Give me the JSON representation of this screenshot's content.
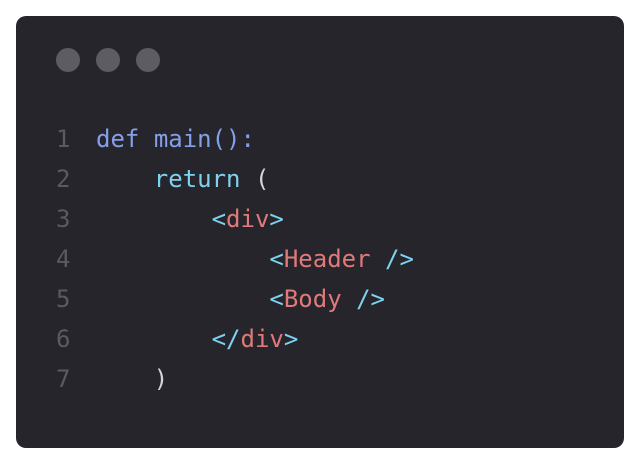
{
  "window": {
    "controls": [
      "dot",
      "dot",
      "dot"
    ],
    "colors": {
      "background": "#26252b",
      "control_dot": "#5d5c62",
      "line_number": "#5b5a60",
      "keyword": "#84a0ea",
      "return_keyword": "#7fd2ef",
      "tag_name": "#e07a7a",
      "punctuation": "#7fd2ef",
      "plain": "#d5d4d9"
    }
  },
  "code": {
    "lines": [
      {
        "number": "1",
        "tokens": [
          {
            "text": "def",
            "type": "kw"
          },
          {
            "text": " ",
            "type": "plain"
          },
          {
            "text": "main",
            "type": "kw"
          },
          {
            "text": "():",
            "type": "kw"
          }
        ]
      },
      {
        "number": "2",
        "tokens": [
          {
            "text": "    ",
            "type": "plain"
          },
          {
            "text": "return",
            "type": "ret"
          },
          {
            "text": " (",
            "type": "plain"
          }
        ]
      },
      {
        "number": "3",
        "tokens": [
          {
            "text": "        ",
            "type": "plain"
          },
          {
            "text": "<",
            "type": "punc"
          },
          {
            "text": "div",
            "type": "tag"
          },
          {
            "text": ">",
            "type": "punc"
          }
        ]
      },
      {
        "number": "4",
        "tokens": [
          {
            "text": "            ",
            "type": "plain"
          },
          {
            "text": "<",
            "type": "punc"
          },
          {
            "text": "Header",
            "type": "tag"
          },
          {
            "text": " ",
            "type": "plain"
          },
          {
            "text": "/>",
            "type": "punc"
          }
        ]
      },
      {
        "number": "5",
        "tokens": [
          {
            "text": "            ",
            "type": "plain"
          },
          {
            "text": "<",
            "type": "punc"
          },
          {
            "text": "Body",
            "type": "tag"
          },
          {
            "text": " ",
            "type": "plain"
          },
          {
            "text": "/>",
            "type": "punc"
          }
        ]
      },
      {
        "number": "6",
        "tokens": [
          {
            "text": "        ",
            "type": "plain"
          },
          {
            "text": "</",
            "type": "punc"
          },
          {
            "text": "div",
            "type": "tag"
          },
          {
            "text": ">",
            "type": "punc"
          }
        ]
      },
      {
        "number": "7",
        "tokens": [
          {
            "text": "    ",
            "type": "plain"
          },
          {
            "text": ")",
            "type": "plain"
          }
        ]
      }
    ]
  }
}
